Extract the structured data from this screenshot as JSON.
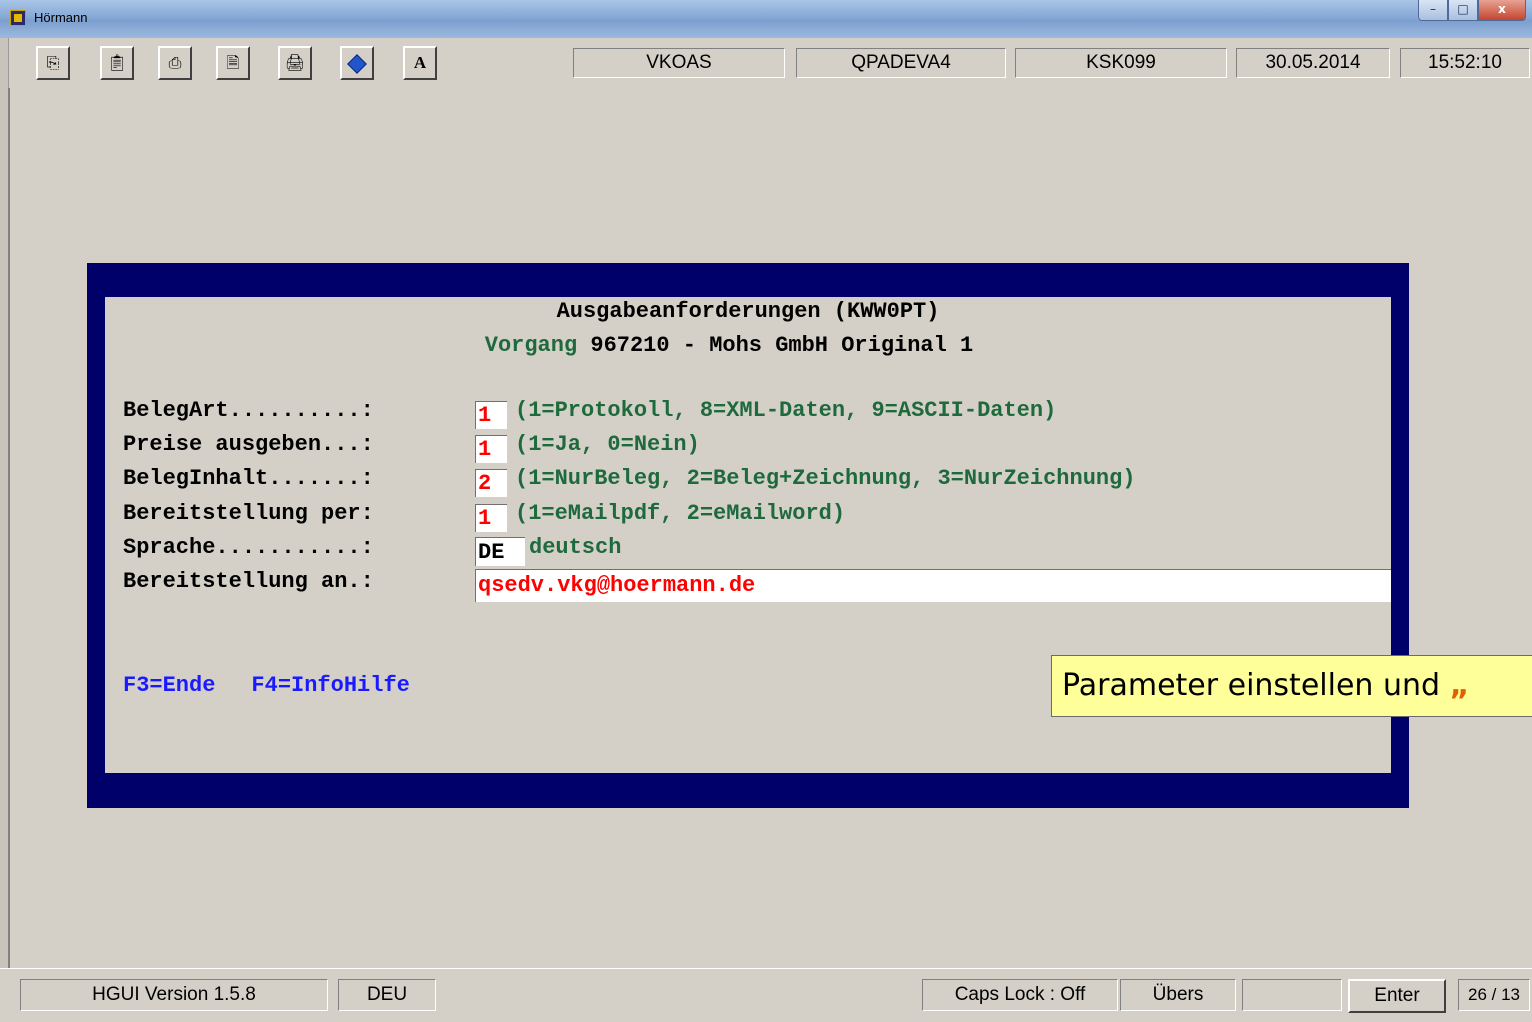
{
  "window": {
    "title": "Hörmann",
    "buttons": {
      "minimize": "–",
      "maximize": "□",
      "close": "x"
    }
  },
  "toolbar": {
    "icons": [
      "copy-icon",
      "paste-icon",
      "print-icon",
      "print-preview-icon",
      "print-screen-icon",
      "diamond-icon",
      "font-icon"
    ],
    "font_button_label": "A",
    "fields": {
      "program": "VKOAS",
      "library": "QPADEVA4",
      "device": "KSK099",
      "date": "30.05.2014",
      "time": "15:52:10"
    }
  },
  "dialog": {
    "title": "Ausgabeanforderungen (KWW0PT)",
    "subtitle_prefix": "Vorgang",
    "subtitle_number": "967210 - Mohs GmbH Original 1",
    "rows": [
      {
        "label": "BelegArt..........:",
        "value": "1",
        "hint": "(1=Protokoll, 8=XML-Daten, 9=ASCII-Daten)"
      },
      {
        "label": "Preise ausgeben...:",
        "value": "1",
        "hint": "(1=Ja, 0=Nein)"
      },
      {
        "label": "BelegInhalt.......:",
        "value": "2",
        "hint": "(1=NurBeleg, 2=Beleg+Zeichnung, 3=NurZeichnung)"
      },
      {
        "label": "Bereitstellung per:",
        "value": "1",
        "hint": "(1=eMailpdf, 2=eMailword)"
      }
    ],
    "language": {
      "label": "Sprache...........:",
      "code": "DE",
      "name": "deutsch"
    },
    "recipient": {
      "label": "Bereitstellung an.:",
      "email": "qsedv.vkg@hoermann.de"
    },
    "fkeys": {
      "f3": "F3=Ende",
      "f4": "F4=InfoHilfe"
    }
  },
  "callout": {
    "text": "Parameter einstellen und ",
    "quote": "„"
  },
  "statusbar": {
    "version": "HGUI Version 1.5.8",
    "language": "DEU",
    "caps_lock": "Caps Lock : Off",
    "overwrite": "Übers",
    "empty": "",
    "enter_button": "Enter",
    "cursor_pos": "26 / 13"
  }
}
